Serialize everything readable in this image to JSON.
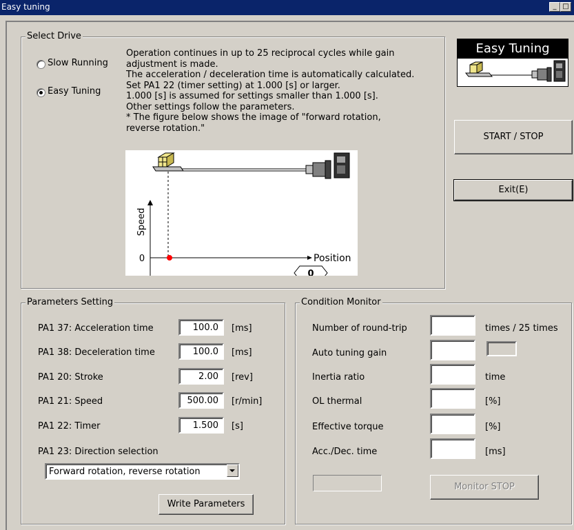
{
  "window": {
    "title": "Easy tuning"
  },
  "select_drive": {
    "group_label": "Select Drive",
    "options": [
      {
        "label": "Slow Running",
        "checked": false
      },
      {
        "label": "Easy Tuning",
        "checked": true
      }
    ],
    "description": "Operation continues in up to 25 reciprocal cycles while gain\nadjustment is made.\nThe acceleration / deceleration time is automatically calculated.\nSet PA1 22 (timer setting) at 1.000 [s] or larger.\n1.000 [s] is assumed for settings smaller than 1.000 [s].\nOther settings follow the parameters.\n* The figure below shows the image of \"forward rotation,\nreverse rotation.\"",
    "figure": {
      "y_axis_label": "Speed",
      "x_axis_label": "Position",
      "zero_label": "0",
      "position_value": "0"
    }
  },
  "logo": {
    "title": "Easy Tuning"
  },
  "buttons": {
    "start_stop": "START / STOP",
    "exit": "Exit(E)",
    "write_parameters": "Write Parameters",
    "monitor_stop": "Monitor STOP"
  },
  "parameters": {
    "group_label": "Parameters Setting",
    "rows": [
      {
        "label": "PA1 37: Acceleration time",
        "value": "100.0",
        "unit": "[ms]"
      },
      {
        "label": "PA1 38: Deceleration time",
        "value": "100.0",
        "unit": "[ms]"
      },
      {
        "label": "PA1 20: Stroke",
        "value": "2.00",
        "unit": "[rev]"
      },
      {
        "label": "PA1 21: Speed",
        "value": "500.00",
        "unit": "[r/min]"
      },
      {
        "label": "PA1 22: Timer",
        "value": "1.500",
        "unit": "[s]"
      }
    ],
    "direction_label": "PA1 23: Direction selection",
    "direction_value": "Forward rotation, reverse rotation"
  },
  "monitor": {
    "group_label": "Condition Monitor",
    "rows": [
      {
        "label": "Number of round-trip",
        "value": "",
        "unit": "times / 25 times"
      },
      {
        "label": "Auto tuning gain",
        "value": "",
        "unit": ""
      },
      {
        "label": "Inertia ratio",
        "value": "",
        "unit": "time"
      },
      {
        "label": "OL thermal",
        "value": "",
        "unit": "[%]"
      },
      {
        "label": "Effective torque",
        "value": "",
        "unit": "[%]"
      },
      {
        "label": "Acc./Dec. time",
        "value": "",
        "unit": "[ms]"
      }
    ]
  },
  "colors": {
    "titlebar": "#0a246a",
    "face": "#d4d0c8",
    "marker": "#ff0000"
  }
}
